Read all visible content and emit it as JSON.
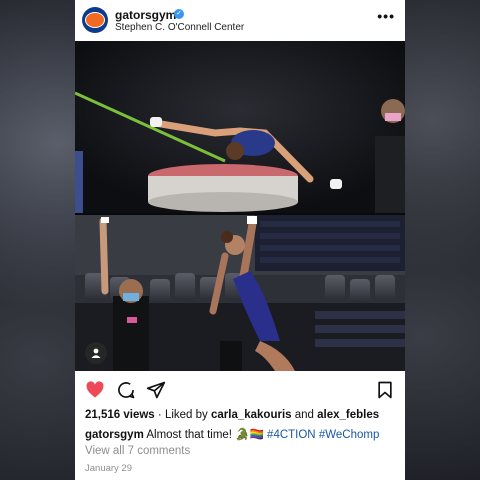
{
  "post": {
    "username": "gatorsgym",
    "location": "Stephen C. O'Connell Center",
    "more_label": "•••",
    "views_count": "21,516 views",
    "liked_by_prefix": "Liked by",
    "liked_by_user1": "carla_kakouris",
    "liked_by_and": "and",
    "liked_by_user2": "alex_febles",
    "caption_user": "gatorsgym",
    "caption_text": "Almost that time!",
    "caption_emoji": "🐊🏳️‍🌈",
    "hashtag1": "#4CTION",
    "hashtag2": "#WeChomp",
    "comments_link": "View all 7 comments",
    "date": "January 29"
  },
  "icons": {
    "verified": "verified-badge-icon",
    "like": "heart-icon",
    "comment": "comment-icon",
    "share": "send-icon",
    "save": "bookmark-icon",
    "user_tag": "person-icon"
  },
  "colors": {
    "like_active": "#ed4956",
    "hashtag": "#1a56a6",
    "muted": "#8e8e8e"
  }
}
